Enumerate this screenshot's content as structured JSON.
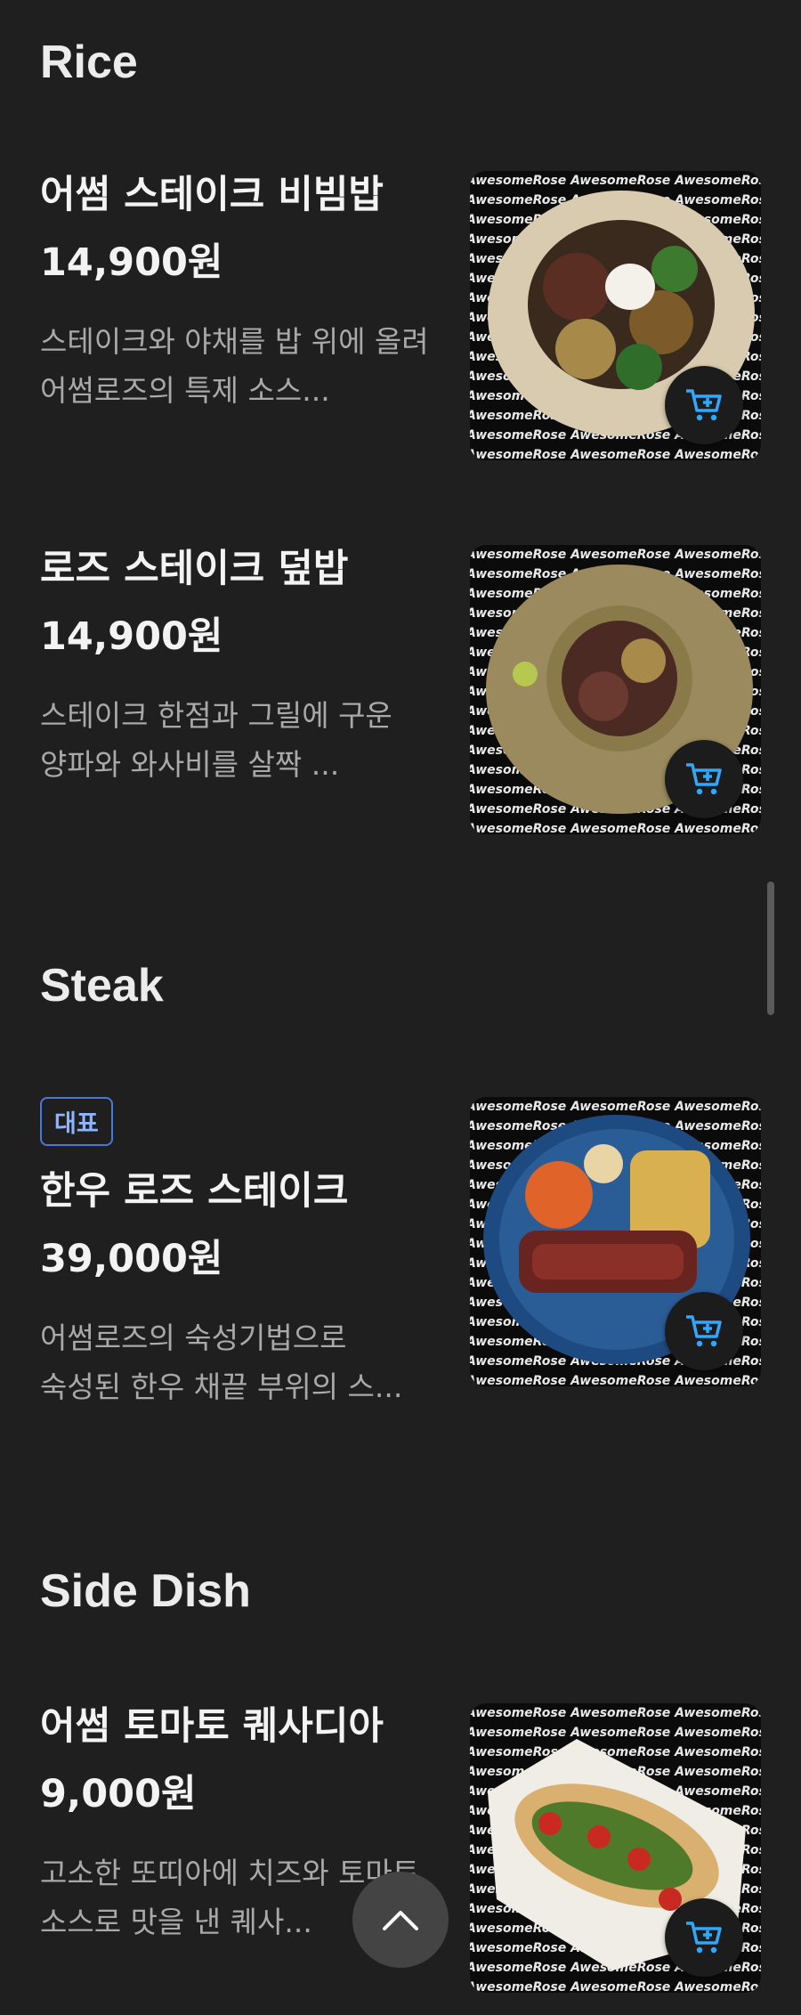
{
  "sections": [
    {
      "title": "Rice"
    },
    {
      "title": "Steak"
    },
    {
      "title": "Side Dish"
    }
  ],
  "items": [
    {
      "name": "어썸 스테이크 비빔밥",
      "price": "14,900원",
      "description": "스테이크와 야채를 밥 위에 올려 어썸로즈의 특제 소스..."
    },
    {
      "name": "로즈 스테이크 덮밥",
      "price": "14,900원",
      "description": "스테이크 한점과 그릴에 구운 양파와 와사비를 살짝 ..."
    },
    {
      "badge": "대표",
      "name": "한우 로즈 스테이크",
      "price": "39,000원",
      "description": "어썸로즈의 숙성기법으로 숙성된 한우 채끝 부위의 스..."
    },
    {
      "name": "어썸 토마토 퀘사디아",
      "price": "9,000원",
      "description": "고소한 또띠아에 치즈와 토마토 소스로 맛을 낸 퀘사..."
    }
  ],
  "watermark": "AwesomeRose AwesomeRose AwesomeRose",
  "icons": {
    "cart": "add-to-cart-icon",
    "scroll_top": "chevron-up-icon"
  },
  "colors": {
    "background": "#1f1f1f",
    "accent": "#2fa8ff",
    "badge": "#4a78d8"
  }
}
